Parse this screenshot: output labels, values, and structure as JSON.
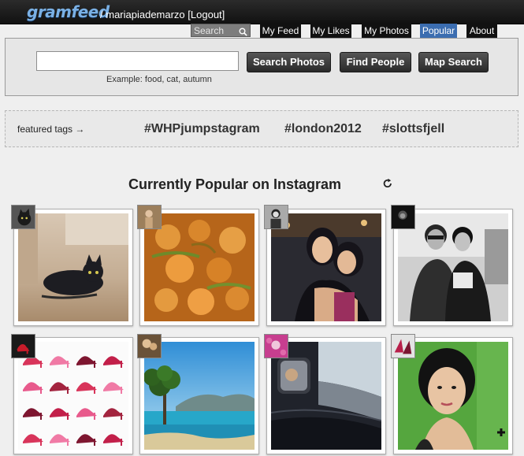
{
  "header": {
    "logo": "gramfeed",
    "username": "mariapiademarzo",
    "logout": "[Logout]"
  },
  "nav": {
    "search_placeholder": "Search",
    "items": [
      {
        "label": "My Feed"
      },
      {
        "label": "My Likes"
      },
      {
        "label": "My Photos"
      },
      {
        "label": "Popular",
        "active": true
      },
      {
        "label": "About"
      }
    ],
    "active_color": "#3b6db0"
  },
  "search_panel": {
    "input_value": "",
    "example": "Example: food, cat, autumn",
    "buttons": [
      "Search Photos",
      "Find People",
      "Map Search"
    ]
  },
  "tags": {
    "label": "featured tags →",
    "items": [
      "#WHPjumpstagram",
      "#london2012",
      "#slottsfjell"
    ]
  },
  "section_title": "Currently Popular on Instagram",
  "photos": [
    {
      "subject": "black cat lying on floor"
    },
    {
      "subject": "shrimp curry dish"
    },
    {
      "subject": "two women hugging"
    },
    {
      "subject": "two men posing black and white"
    },
    {
      "subject": "grid of high heel shoes"
    },
    {
      "subject": "tree by the sea"
    },
    {
      "subject": "car side mirror"
    },
    {
      "subject": "woman portrait green background"
    }
  ]
}
